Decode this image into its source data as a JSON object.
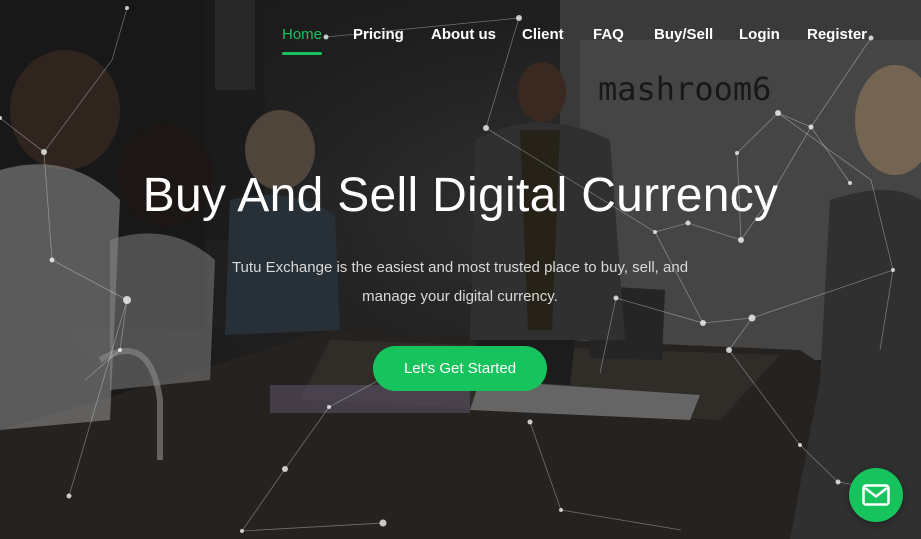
{
  "nav": {
    "items": [
      {
        "label": "Home",
        "active": true
      },
      {
        "label": "Pricing"
      },
      {
        "label": "About us"
      },
      {
        "label": "Client"
      },
      {
        "label": "FAQ"
      },
      {
        "label": "Buy/Sell"
      },
      {
        "label": "Login"
      },
      {
        "label": "Register"
      }
    ]
  },
  "hero": {
    "background_sign": "mashroom6",
    "title": "Buy And Sell Digital Currency",
    "subtitle": "Tutu Exchange is the easiest and most trusted place to buy, sell, and manage your digital currency.",
    "cta_label": "Let's Get Started"
  },
  "chat_widget": {
    "icon": "envelope-icon"
  },
  "colors": {
    "accent": "#16c35c",
    "text": "#ffffff",
    "subtitle": "#d9d9d9"
  }
}
